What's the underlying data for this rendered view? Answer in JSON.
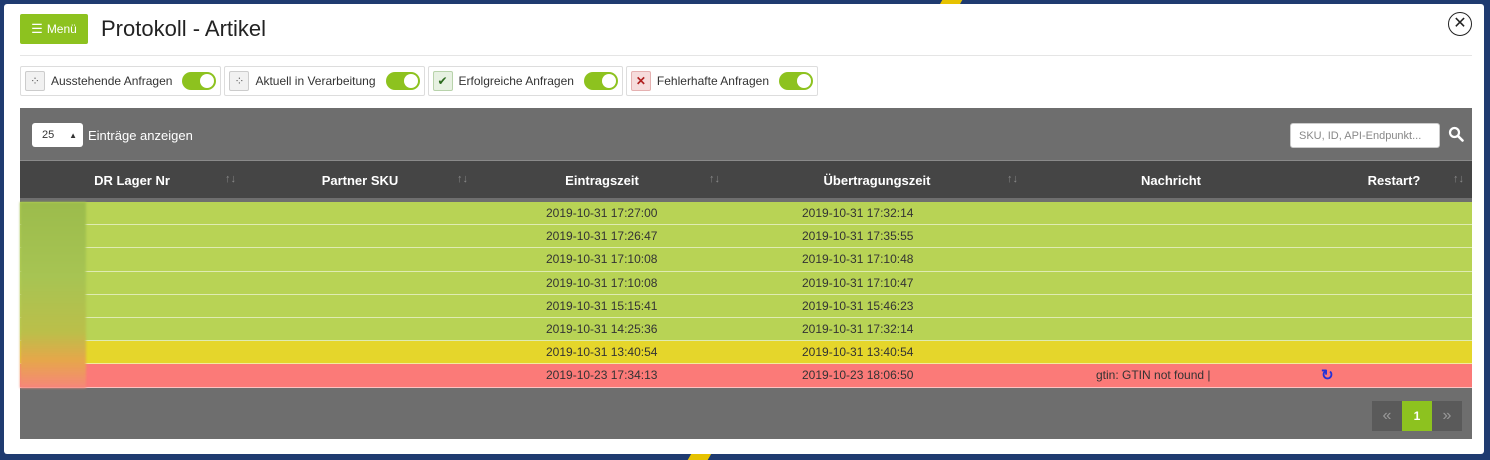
{
  "header": {
    "menu_label": "Menü",
    "title": "Protokoll - Artikel"
  },
  "filters": [
    {
      "label": "Ausstehende Anfragen",
      "icon": "pending-spinner-icon",
      "enabled": true
    },
    {
      "label": "Aktuell in Verarbeitung",
      "icon": "processing-spinner-icon",
      "enabled": true
    },
    {
      "label": "Erfolgreiche Anfragen",
      "icon": "check-icon",
      "enabled": true
    },
    {
      "label": "Fehlerhafte Anfragen",
      "icon": "cross-icon",
      "enabled": true
    }
  ],
  "toolbar": {
    "page_size": "25",
    "page_size_label": "Einträge anzeigen",
    "search_placeholder": "SKU, ID, API-Endpunkt..."
  },
  "table": {
    "columns": [
      "DR Lager Nr",
      "Partner SKU",
      "Eintragszeit",
      "Übertragungszeit",
      "Nachricht",
      "Restart?"
    ],
    "rows": [
      {
        "status": "success",
        "lager_nr": "",
        "partner_sku": "",
        "eintragszeit": "2019-10-31 17:27:00",
        "uebertragungszeit": "2019-10-31 17:32:14",
        "nachricht": "",
        "restart": false
      },
      {
        "status": "success",
        "lager_nr": "",
        "partner_sku": "",
        "eintragszeit": "2019-10-31 17:26:47",
        "uebertragungszeit": "2019-10-31 17:35:55",
        "nachricht": "",
        "restart": false
      },
      {
        "status": "success",
        "lager_nr": "",
        "partner_sku": "",
        "eintragszeit": "2019-10-31 17:10:08",
        "uebertragungszeit": "2019-10-31 17:10:48",
        "nachricht": "",
        "restart": false
      },
      {
        "status": "success",
        "lager_nr": "",
        "partner_sku": "",
        "eintragszeit": "2019-10-31 17:10:08",
        "uebertragungszeit": "2019-10-31 17:10:47",
        "nachricht": "",
        "restart": false
      },
      {
        "status": "success",
        "lager_nr": "",
        "partner_sku": "",
        "eintragszeit": "2019-10-31 15:15:41",
        "uebertragungszeit": "2019-10-31 15:46:23",
        "nachricht": "",
        "restart": false
      },
      {
        "status": "success",
        "lager_nr": "",
        "partner_sku": "",
        "eintragszeit": "2019-10-31 14:25:36",
        "uebertragungszeit": "2019-10-31 17:32:14",
        "nachricht": "",
        "restart": false
      },
      {
        "status": "pending",
        "lager_nr": "",
        "partner_sku": "",
        "eintragszeit": "2019-10-31 13:40:54",
        "uebertragungszeit": "2019-10-31 13:40:54",
        "nachricht": "",
        "restart": false
      },
      {
        "status": "error",
        "lager_nr": "",
        "partner_sku": "",
        "eintragszeit": "2019-10-23 17:34:13",
        "uebertragungszeit": "2019-10-23 18:06:50",
        "nachricht": "gtin: GTIN not found |",
        "restart": true
      }
    ]
  },
  "pagination": {
    "prev": "«",
    "current": "1",
    "next": "»"
  },
  "colors": {
    "accent": "#8dc21f",
    "success_row": "#b8d355",
    "pending_row": "#e5d62b",
    "error_row": "#fb7a78",
    "restart_icon": "#2232d8"
  }
}
